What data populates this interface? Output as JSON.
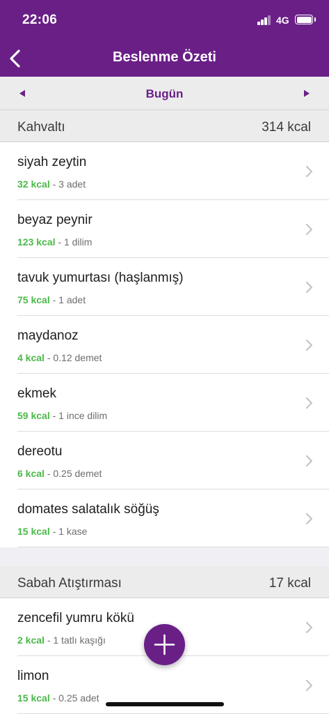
{
  "status": {
    "time": "22:06",
    "network": "4G"
  },
  "nav": {
    "title": "Beslenme Özeti"
  },
  "date_bar": {
    "label": "Bugün"
  },
  "breakfast": {
    "title": "Kahvaltı",
    "kcal": "314 kcal",
    "items": [
      {
        "name": "siyah zeytin",
        "kcal": "32 kcal",
        "portion": " - 3 adet"
      },
      {
        "name": "beyaz peynir",
        "kcal": "123 kcal",
        "portion": " - 1 dilim"
      },
      {
        "name": "tavuk yumurtası (haşlanmış)",
        "kcal": "75 kcal",
        "portion": " - 1 adet"
      },
      {
        "name": "maydanoz",
        "kcal": "4 kcal",
        "portion": " - 0.12 demet"
      },
      {
        "name": "ekmek",
        "kcal": "59 kcal",
        "portion": " - 1 ince dilim"
      },
      {
        "name": "dereotu",
        "kcal": "6 kcal",
        "portion": " - 0.25 demet"
      },
      {
        "name": "domates salatalık söğüş",
        "kcal": "15 kcal",
        "portion": " - 1 kase"
      }
    ]
  },
  "morning_snack": {
    "title": "Sabah Atıştırması",
    "kcal": "17 kcal",
    "items": [
      {
        "name": "zencefil yumru kökü",
        "kcal": "2 kcal",
        "portion": " - 1 tatlı kaşığı"
      },
      {
        "name": "limon",
        "kcal": "15 kcal",
        "portion": " - 0.25 adet"
      }
    ]
  },
  "colors": {
    "brand": "#6a1f87",
    "kcal_green": "#4cb84a"
  },
  "icons": {
    "back": "chevron-left-icon",
    "prev": "triangle-left-icon",
    "next": "triangle-right-icon",
    "row": "chevron-right-icon",
    "fab": "plus-icon"
  }
}
